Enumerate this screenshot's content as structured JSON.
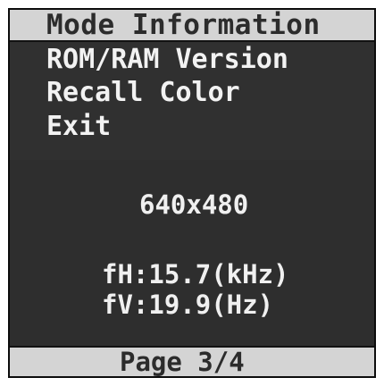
{
  "menu": {
    "title": "Mode Information",
    "items": [
      {
        "label": "ROM/RAM Version"
      },
      {
        "label": "Recall Color"
      },
      {
        "label": "Exit"
      }
    ]
  },
  "info": {
    "resolution": "640x480",
    "fh": "fH:15.7(kHz)",
    "fv": "fV:19.9(Hz)"
  },
  "footer": {
    "page": "Page 3/4"
  },
  "colors": {
    "background": "#2a2a2a",
    "header_bg": "#d4d4d4",
    "text_light": "#f2f2f2",
    "text_dark": "#2c2c2c"
  }
}
